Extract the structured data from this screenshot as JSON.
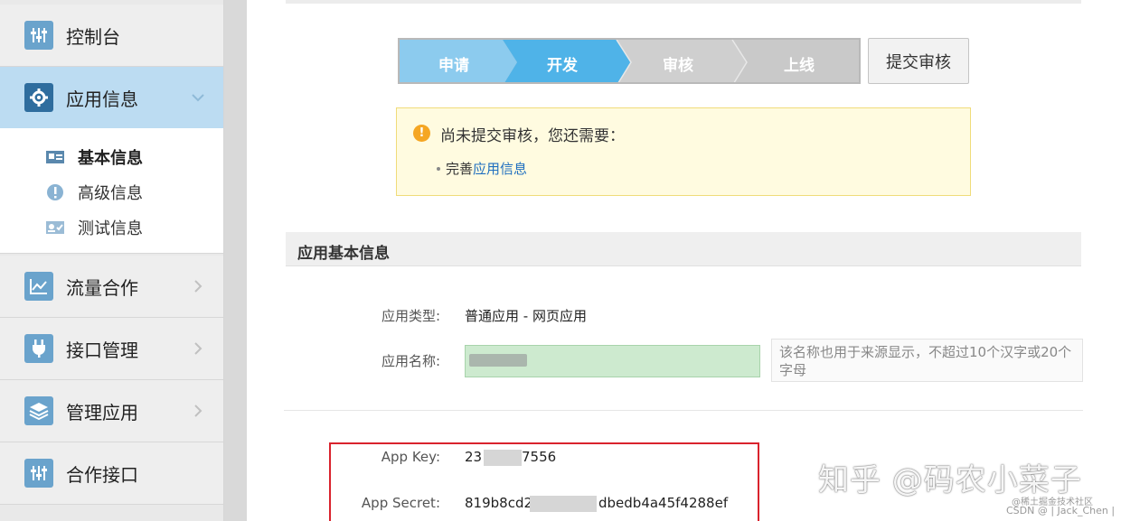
{
  "sidebar": {
    "items": [
      {
        "label": "控制台",
        "icon": "dashboard-icon"
      },
      {
        "label": "应用信息",
        "icon": "gear-icon"
      },
      {
        "label": "流量合作",
        "icon": "chart-icon"
      },
      {
        "label": "接口管理",
        "icon": "plug-icon"
      },
      {
        "label": "管理应用",
        "icon": "layers-icon"
      },
      {
        "label": "合作接口",
        "icon": "sliders-icon"
      }
    ],
    "subitems": [
      {
        "label": "基本信息",
        "icon": "id-card-icon"
      },
      {
        "label": "高级信息",
        "icon": "info-icon"
      },
      {
        "label": "测试信息",
        "icon": "user-card-icon"
      }
    ]
  },
  "steps": {
    "items": [
      "申请",
      "开发",
      "审核",
      "上线"
    ],
    "current": "开发",
    "colors": {
      "active": "#8ccbee",
      "current": "#4fb3e8",
      "inactive": "#cfcfcf"
    }
  },
  "submit_button": "提交审核",
  "notice": {
    "title": "尚未提交审核，您还需要：",
    "item_prefix": "完善",
    "item_link": "应用信息"
  },
  "section": {
    "title": "应用基本信息",
    "app_type_label": "应用类型:",
    "app_type_value": "普通应用  -  网页应用",
    "app_name_label": "应用名称:",
    "app_name_hint": "该名称也用于来源显示，不超过10个汉字或20个字母",
    "app_key_label": "App Key:",
    "app_key_prefix": "23",
    "app_key_suffix": "7556",
    "app_secret_label": "App Secret:",
    "app_secret_prefix": "819b8cd2",
    "app_secret_suffix": "dbedb4a45f4288ef"
  },
  "watermark": {
    "main": "知乎 @码农小菜子",
    "small": "@稀土掘金技术社区",
    "csdn": "CSDN @ | Jack_Chen |"
  }
}
